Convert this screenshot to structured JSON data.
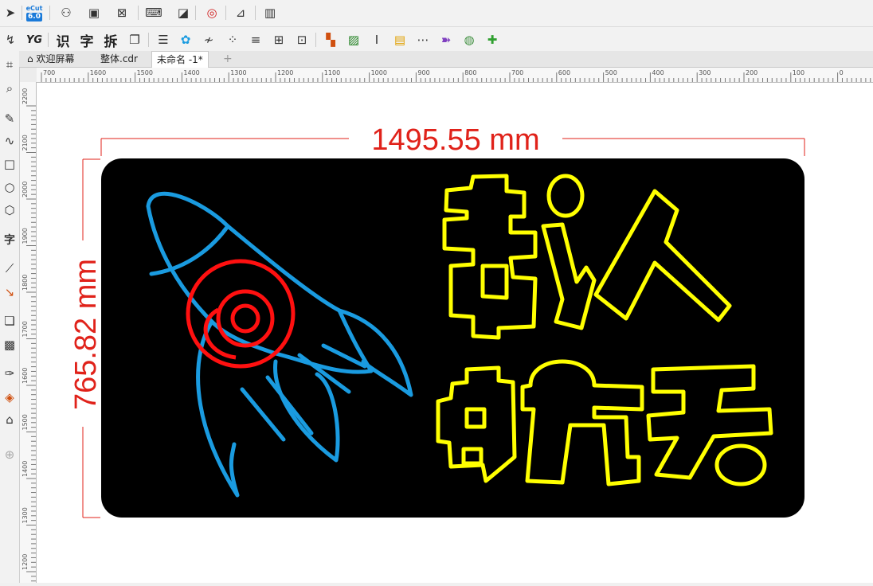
{
  "app": {
    "logo_top": "eCut",
    "logo_version": "6.0"
  },
  "toolbar2": {
    "recognize": "识",
    "character": "字",
    "split": "拆",
    "yg": "YG"
  },
  "tabs": [
    {
      "label": "欢迎屏幕"
    },
    {
      "label": "整体.cdr"
    },
    {
      "label": "未命名 -1*"
    }
  ],
  "left_tools": {
    "text_tool": "字"
  },
  "ruler": {
    "horizontal": [
      "700",
      "1600",
      "1500",
      "1400",
      "1300",
      "1200",
      "1100",
      "1000",
      "900",
      "800",
      "700",
      "600",
      "500",
      "400",
      "300",
      "200",
      "100",
      "0"
    ],
    "vertical": [
      "2200",
      "2100",
      "2000",
      "1900",
      "1800",
      "1700",
      "1600",
      "1500",
      "1400",
      "1300",
      "1200"
    ]
  },
  "dimensions": {
    "width_label": "1495.55 mm",
    "height_label": "765.82 mm",
    "color": "#e0221a"
  },
  "colors": {
    "neon_blue": "#1a9be0",
    "neon_red": "#ff1010",
    "neon_yellow": "#ffff00",
    "panel": "#000000"
  }
}
